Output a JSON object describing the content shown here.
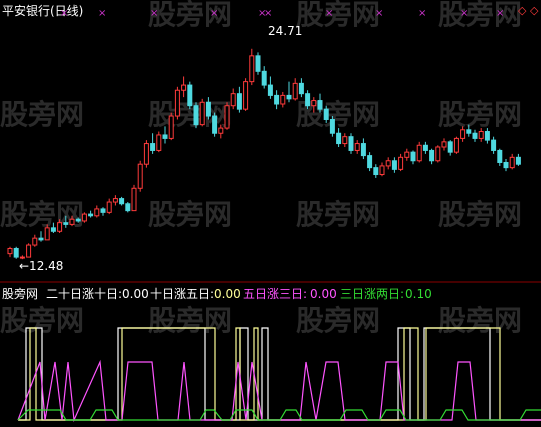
{
  "title": "平安银行(日线)",
  "watermark": "股旁网",
  "colors": {
    "up": "#ff3b3b",
    "down": "#4fd9e0",
    "marker": "#cc33cc",
    "text": "#ffffff",
    "line_a": "#ffffff",
    "line_b": "#ffff99",
    "line_c": "#ff55ff",
    "line_d": "#33dd33"
  },
  "price_panel": {
    "high_label": "24.71",
    "low_label": "←12.48"
  },
  "chart_data": [
    {
      "type": "candlestick",
      "title": "平安银行(日线)",
      "y_range": [
        11.5,
        26.5
      ],
      "annotations": [
        "24.71",
        "12.48"
      ],
      "candles": [
        [
          12.8,
          13.2,
          12.6,
          13.1
        ],
        [
          13.1,
          13.2,
          12.5,
          12.6
        ],
        [
          12.6,
          12.7,
          12.48,
          12.6
        ],
        [
          12.6,
          13.4,
          12.6,
          13.3
        ],
        [
          13.3,
          13.9,
          13.2,
          13.7
        ],
        [
          13.7,
          14.1,
          13.5,
          13.6
        ],
        [
          13.6,
          14.5,
          13.6,
          14.3
        ],
        [
          14.3,
          14.6,
          14.0,
          14.1
        ],
        [
          14.1,
          14.8,
          14.0,
          14.6
        ],
        [
          14.6,
          15.0,
          14.3,
          14.5
        ],
        [
          14.5,
          15.0,
          14.4,
          14.8
        ],
        [
          14.8,
          14.9,
          14.6,
          14.7
        ],
        [
          14.7,
          15.2,
          14.6,
          15.1
        ],
        [
          15.1,
          15.3,
          14.9,
          15.0
        ],
        [
          15.0,
          15.6,
          14.9,
          15.4
        ],
        [
          15.4,
          15.5,
          15.0,
          15.2
        ],
        [
          15.2,
          16.0,
          15.1,
          15.8
        ],
        [
          15.8,
          16.2,
          15.6,
          16.0
        ],
        [
          16.0,
          16.1,
          15.6,
          15.7
        ],
        [
          15.7,
          15.8,
          15.2,
          15.3
        ],
        [
          15.3,
          16.8,
          15.3,
          16.6
        ],
        [
          16.6,
          18.2,
          16.4,
          18.0
        ],
        [
          18.0,
          19.4,
          17.8,
          19.2
        ],
        [
          19.2,
          19.8,
          18.6,
          18.8
        ],
        [
          18.8,
          19.9,
          18.7,
          19.7
        ],
        [
          19.7,
          20.2,
          19.2,
          19.5
        ],
        [
          19.5,
          21.0,
          19.4,
          20.8
        ],
        [
          20.8,
          22.5,
          20.6,
          22.3
        ],
        [
          22.3,
          23.1,
          21.9,
          22.6
        ],
        [
          22.6,
          22.8,
          21.2,
          21.4
        ],
        [
          21.4,
          21.6,
          20.1,
          20.3
        ],
        [
          20.3,
          21.8,
          20.2,
          21.6
        ],
        [
          21.6,
          21.9,
          20.6,
          20.8
        ],
        [
          20.8,
          21.0,
          19.6,
          19.8
        ],
        [
          19.8,
          20.3,
          19.5,
          20.1
        ],
        [
          20.1,
          21.6,
          20.0,
          21.4
        ],
        [
          21.4,
          22.4,
          21.2,
          22.1
        ],
        [
          22.1,
          22.5,
          21.0,
          21.2
        ],
        [
          21.2,
          23.0,
          21.1,
          22.8
        ],
        [
          22.8,
          24.71,
          22.6,
          24.3
        ],
        [
          24.3,
          24.5,
          23.2,
          23.4
        ],
        [
          23.4,
          23.7,
          22.4,
          22.6
        ],
        [
          22.6,
          23.1,
          21.8,
          22.0
        ],
        [
          22.0,
          22.3,
          21.2,
          21.5
        ],
        [
          21.5,
          22.2,
          21.3,
          22.0
        ],
        [
          22.0,
          22.8,
          21.6,
          21.8
        ],
        [
          21.8,
          23.0,
          21.7,
          22.7
        ],
        [
          22.7,
          23.0,
          21.9,
          22.1
        ],
        [
          22.1,
          22.3,
          21.2,
          21.4
        ],
        [
          21.4,
          21.9,
          21.0,
          21.7
        ],
        [
          21.7,
          22.1,
          21.0,
          21.2
        ],
        [
          21.2,
          21.4,
          20.4,
          20.6
        ],
        [
          20.6,
          20.8,
          19.6,
          19.8
        ],
        [
          19.8,
          20.1,
          19.0,
          19.2
        ],
        [
          19.2,
          19.8,
          19.0,
          19.6
        ],
        [
          19.6,
          19.8,
          18.6,
          18.8
        ],
        [
          18.8,
          19.4,
          18.6,
          19.2
        ],
        [
          19.2,
          19.5,
          18.3,
          18.5
        ],
        [
          18.5,
          18.7,
          17.6,
          17.8
        ],
        [
          17.8,
          18.0,
          17.2,
          17.4
        ],
        [
          17.4,
          18.1,
          17.3,
          17.9
        ],
        [
          17.9,
          18.4,
          17.7,
          18.2
        ],
        [
          18.2,
          18.4,
          17.5,
          17.7
        ],
        [
          17.7,
          18.6,
          17.6,
          18.4
        ],
        [
          18.4,
          18.9,
          18.2,
          18.7
        ],
        [
          18.7,
          18.8,
          18.0,
          18.2
        ],
        [
          18.2,
          19.3,
          18.1,
          19.1
        ],
        [
          19.1,
          19.3,
          18.6,
          18.8
        ],
        [
          18.8,
          18.9,
          18.0,
          18.2
        ],
        [
          18.2,
          19.1,
          18.1,
          19.0
        ],
        [
          19.0,
          19.5,
          18.8,
          19.3
        ],
        [
          19.3,
          19.4,
          18.5,
          18.7
        ],
        [
          18.7,
          19.6,
          18.6,
          19.5
        ],
        [
          19.5,
          20.2,
          19.3,
          20.0
        ],
        [
          20.0,
          20.3,
          19.6,
          19.8
        ],
        [
          19.8,
          20.0,
          19.3,
          19.5
        ],
        [
          19.5,
          20.1,
          19.3,
          19.9
        ],
        [
          19.9,
          20.1,
          19.2,
          19.4
        ],
        [
          19.4,
          19.6,
          18.6,
          18.8
        ],
        [
          18.8,
          18.9,
          17.9,
          18.1
        ],
        [
          18.1,
          18.3,
          17.6,
          17.8
        ],
        [
          17.8,
          18.6,
          17.7,
          18.4
        ],
        [
          18.4,
          18.6,
          17.9,
          18.0
        ]
      ]
    },
    {
      "type": "line",
      "series": [
        {
          "name": "二十日涨十日",
          "value_label": "0.00",
          "color": "#ffffff"
        },
        {
          "name": "十日涨五日",
          "value_label": "0.00",
          "color": "#ffff99"
        },
        {
          "name": "五日涨三日",
          "value_label": "0.00",
          "color": "#ff55ff"
        },
        {
          "name": "三日涨两日",
          "value_label": "0.10",
          "color": "#33dd33"
        }
      ]
    }
  ],
  "indicator_header": {
    "source": "股旁网",
    "items": [
      {
        "label": "二十日涨十日:",
        "value": "0.00"
      },
      {
        "label": "十日涨五日:",
        "value": "0.00"
      },
      {
        "label": "五日涨三日:",
        "value": "0.00"
      },
      {
        "label": "三日涨两日:",
        "value": "0.10"
      }
    ]
  }
}
